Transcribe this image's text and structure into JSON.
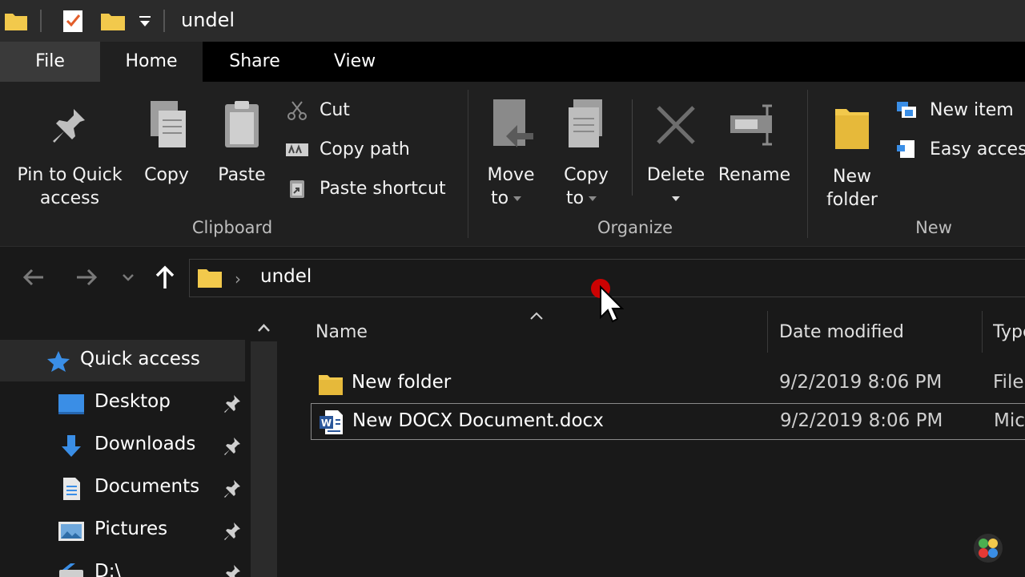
{
  "window": {
    "title": "undel"
  },
  "tabs": [
    {
      "label": "File"
    },
    {
      "label": "Home"
    },
    {
      "label": "Share"
    },
    {
      "label": "View"
    }
  ],
  "ribbon": {
    "clipboard": {
      "label": "Clipboard",
      "pin_line1": "Pin to Quick",
      "pin_line2": "access",
      "copy": "Copy",
      "paste": "Paste",
      "cut": "Cut",
      "copy_path": "Copy path",
      "paste_shortcut": "Paste shortcut"
    },
    "organize": {
      "label": "Organize",
      "move_line1": "Move",
      "move_line2": "to",
      "copy_line1": "Copy",
      "copy_line2": "to",
      "delete": "Delete",
      "rename": "Rename"
    },
    "new": {
      "label": "New",
      "folder_line1": "New",
      "folder_line2": "folder",
      "new_item": "New item",
      "easy_access": "Easy access"
    }
  },
  "address": {
    "path": "undel"
  },
  "navigation": {
    "items": [
      {
        "label": "Quick access"
      },
      {
        "label": "Desktop"
      },
      {
        "label": "Downloads"
      },
      {
        "label": "Documents"
      },
      {
        "label": "Pictures"
      },
      {
        "label": "D:\\"
      }
    ]
  },
  "columns": {
    "name": "Name",
    "date": "Date modified",
    "type": "Type"
  },
  "files": [
    {
      "name": "New folder",
      "date": "9/2/2019 8:06 PM",
      "type": "File folder"
    },
    {
      "name": "New DOCX Document.docx",
      "date": "9/2/2019 8:06 PM",
      "type": "Microsoft Word Document"
    }
  ],
  "colors": {
    "folder": "#f2c94c",
    "accent_blue": "#3a8ee6",
    "background": "#191919",
    "ribbon": "#202020"
  }
}
